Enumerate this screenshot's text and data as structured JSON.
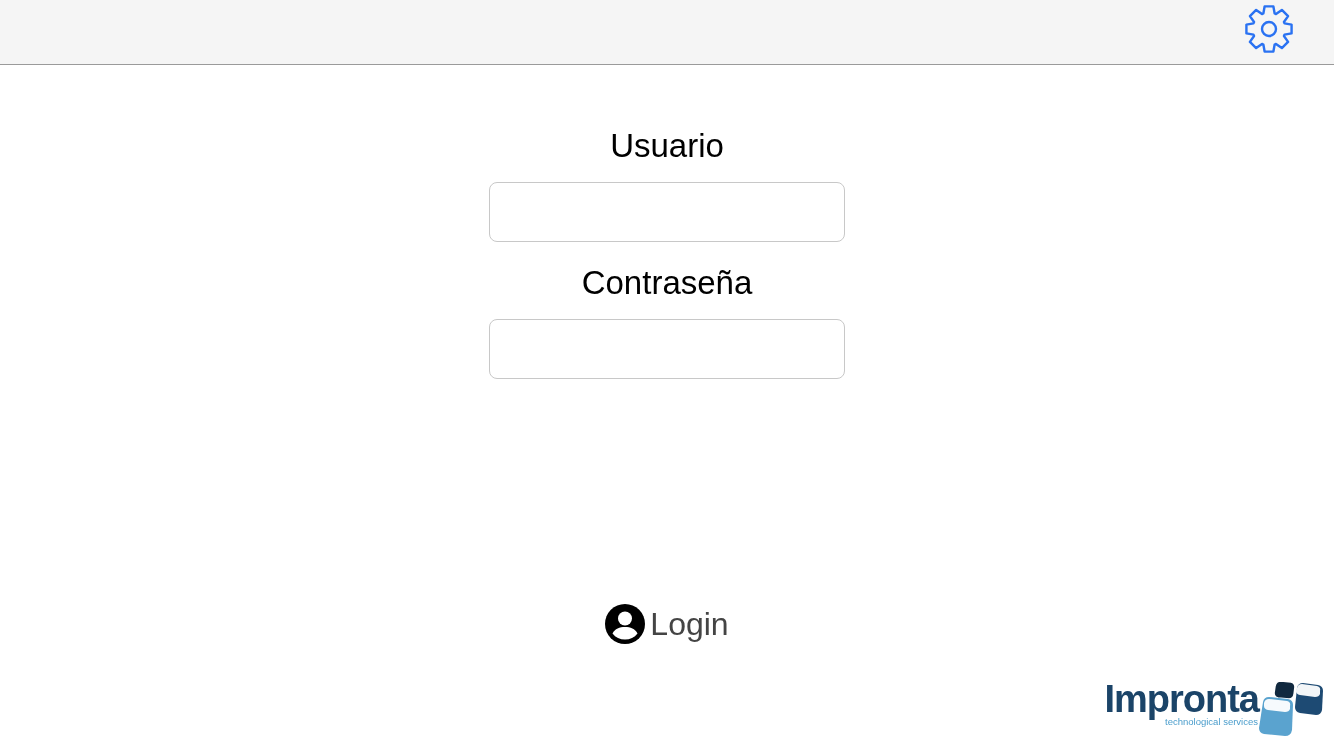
{
  "form": {
    "fields": [
      {
        "label": "Usuario"
      },
      {
        "label": "Contraseña"
      }
    ]
  },
  "login_button": {
    "label": "Login"
  },
  "logo": {
    "name": "Impronta",
    "tagline": "technological services"
  }
}
